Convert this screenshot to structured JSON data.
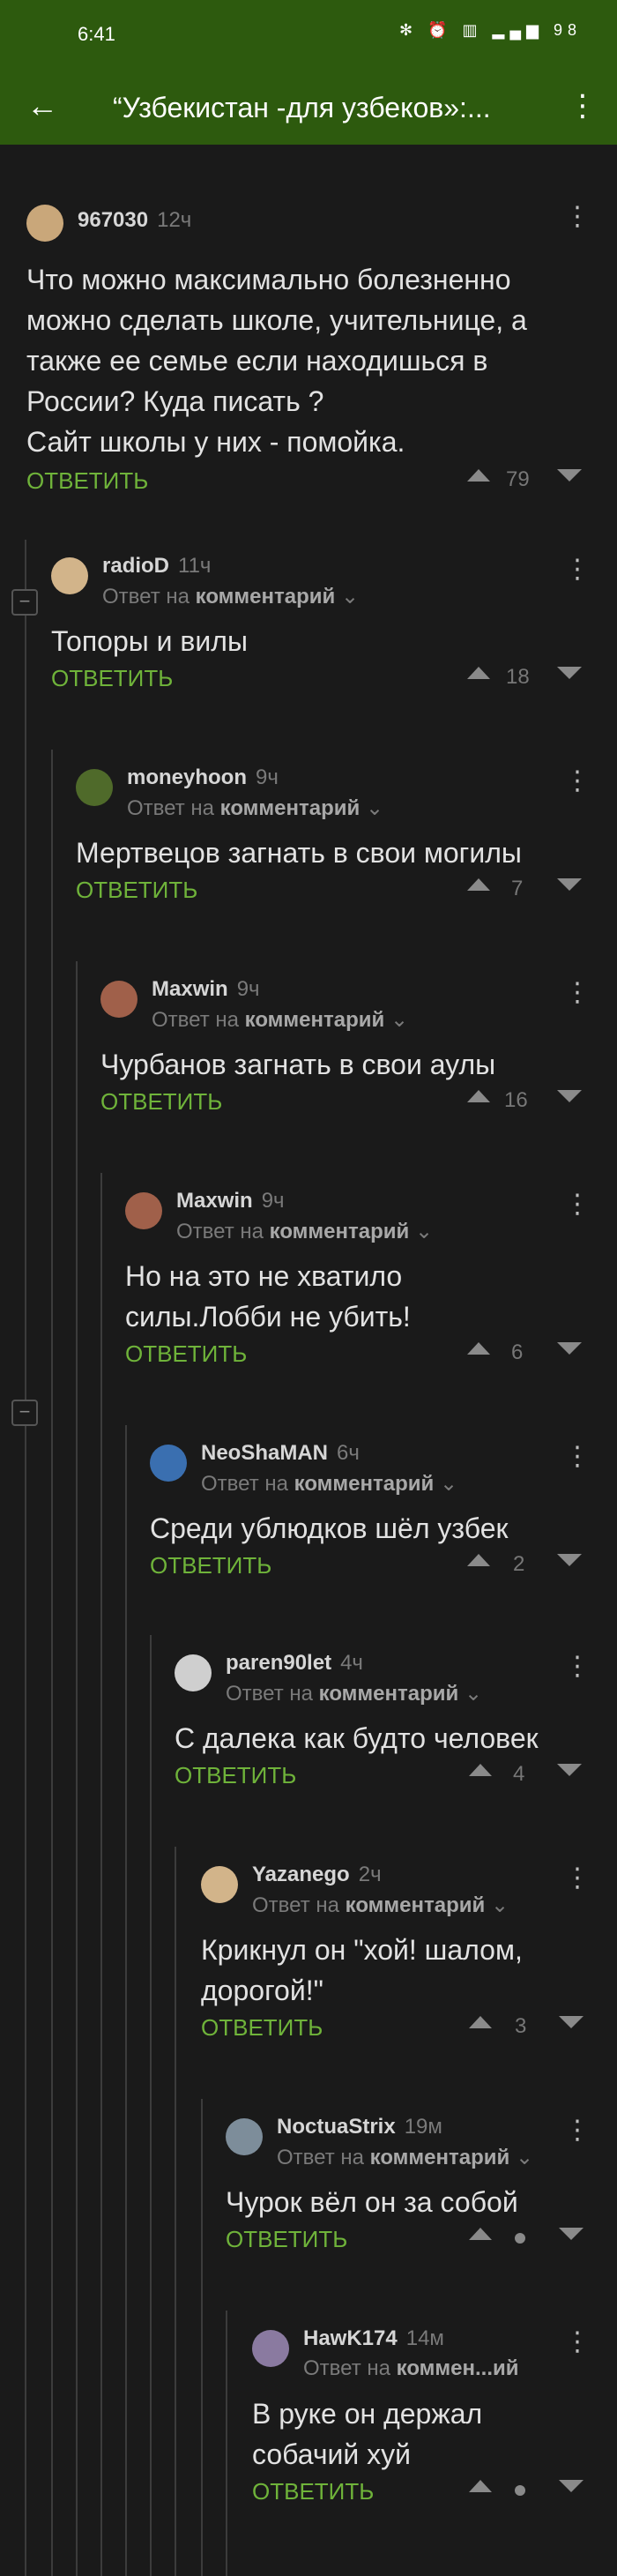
{
  "status_bar": {
    "time": "6:41",
    "icons": "✻ ⏰ ▥ ▂▄▆ 98"
  },
  "toolbar": {
    "back_icon": "arrow-left-icon",
    "title": "“Узбекистан -для узбеков»:...",
    "more_icon": "more-vertical-icon"
  },
  "reply_label": "ОТВЕТИТЬ",
  "reply_prefix": "Ответ на",
  "reply_target": "комментарий",
  "comments": [
    {
      "author": "967030",
      "age": "12ч",
      "text": "Что можно максимально болезненно можно сделать школе, учительнице, а также ее семье если находишься в России? Куда писать ?\nСайт школы у них - помойка.",
      "score": "79"
    },
    {
      "author": "radioD",
      "age": "11ч",
      "text": "Топоры и вилы",
      "score": "18"
    },
    {
      "author": "moneyhoon",
      "age": "9ч",
      "text": "Мертвецов загнать в свои могилы",
      "score": "7"
    },
    {
      "author": "Maxwin",
      "age": "9ч",
      "text": "Чурбанов загнать в свои аулы",
      "score": "16"
    },
    {
      "author": "Maxwin",
      "age": "9ч",
      "text": "Но на это не хватило силы.Лобби не убить!",
      "score": "6"
    },
    {
      "author": "NeoShaMAN",
      "age": "6ч",
      "text": "Среди ублюдков шёл узбек",
      "score": "2"
    },
    {
      "author": "paren90let",
      "age": "4ч",
      "text": "С далека как будто человек",
      "score": "4"
    },
    {
      "author": "Yazanego",
      "age": "2ч",
      "text": "Крикнул он \"хой! шалом, дорогой!\"",
      "score": "3"
    },
    {
      "author": "NoctuaStrix",
      "age": "19м",
      "text": "Чурок вёл он за собой",
      "score": ""
    },
    {
      "author": "HawK174",
      "age": "14м",
      "text": "В руке он держал собачий хуй",
      "score": "",
      "reply_target_short": "коммен...ий"
    }
  ],
  "colors": {
    "header": "#2d5a0e",
    "reply": "#6fb33a",
    "background": "#1a1a1a"
  }
}
